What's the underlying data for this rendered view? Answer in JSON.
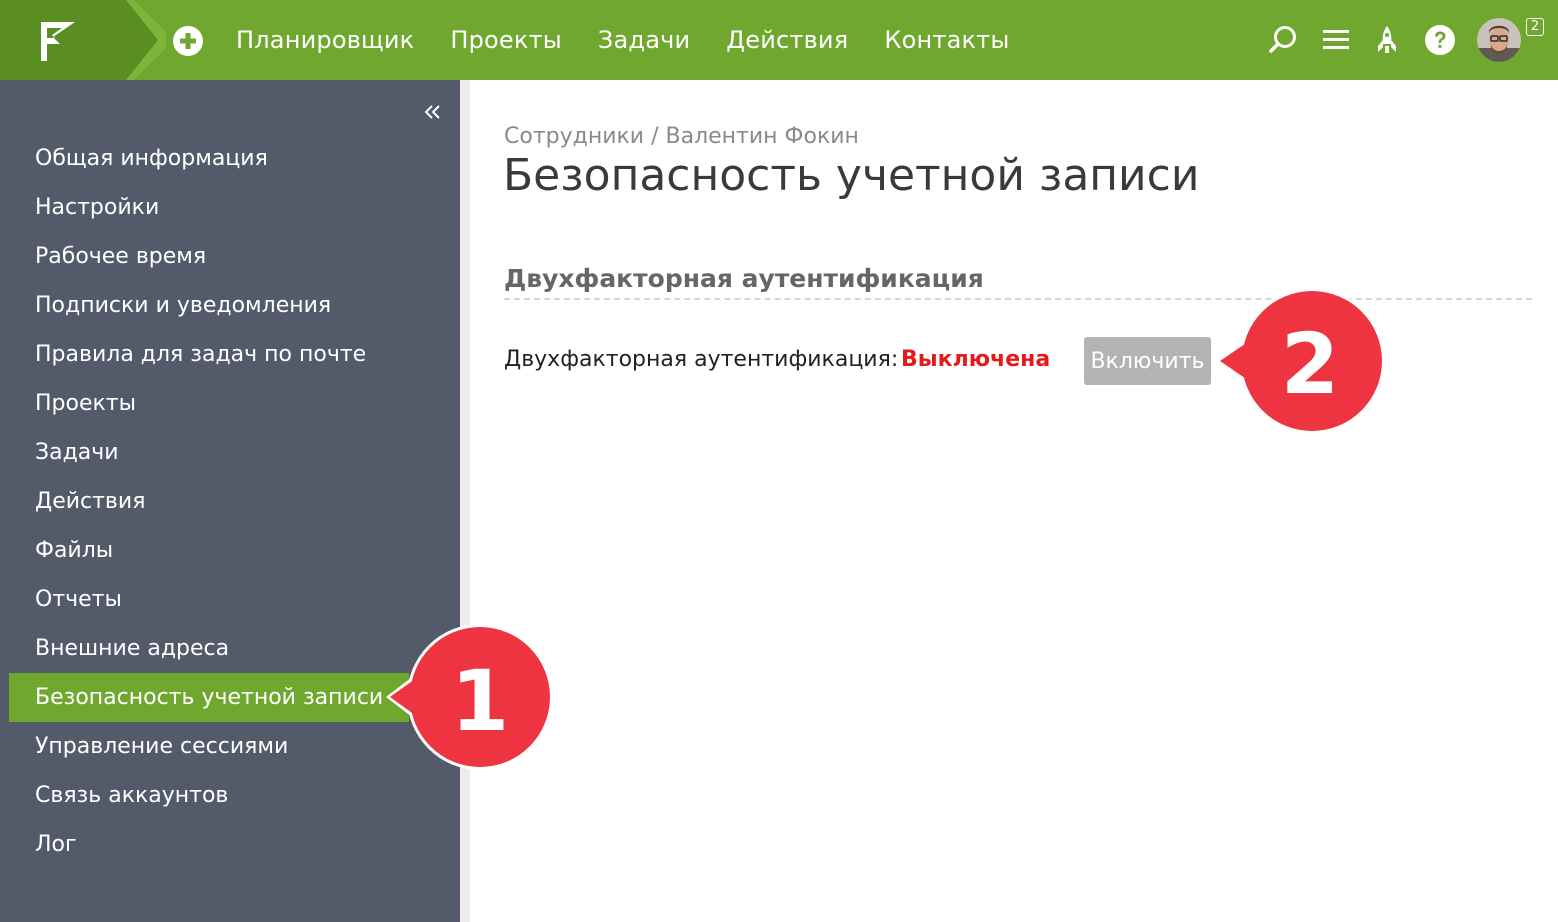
{
  "topbar": {
    "nav": [
      "Планировщик",
      "Проекты",
      "Задачи",
      "Действия",
      "Контакты"
    ],
    "notifications_count": "2",
    "colors": {
      "bar": "#70a82f",
      "logo_bg": "#5b8e22"
    },
    "icons": [
      "flag-logo-icon",
      "plus-circle-icon",
      "search-icon",
      "menu-icon",
      "rocket-icon",
      "help-icon"
    ]
  },
  "sidebar": {
    "items": [
      "Общая информация",
      "Настройки",
      "Рабочее время",
      "Подписки и уведомления",
      "Правила для задач по почте",
      "Проекты",
      "Задачи",
      "Действия",
      "Файлы",
      "Отчеты",
      "Внешние адреса",
      "Безопасность учетной записи",
      "Управление сессиями",
      "Связь аккаунтов",
      "Лог"
    ],
    "active_index": 11,
    "colors": {
      "bg": "#535a6a",
      "active": "#70a82f"
    }
  },
  "main": {
    "breadcrumb": {
      "parent": "Сотрудники",
      "separator": " / ",
      "current": "Валентин Фокин"
    },
    "title": "Безопасность учетной записи",
    "section_title": "Двухфакторная аутентификация",
    "tfa_label": "Двухфакторная аутентификация:",
    "tfa_status": "Выключена",
    "enable_button": "Включить",
    "colors": {
      "status": "#e51b1b",
      "button": "#b3b3b3"
    }
  },
  "callouts": {
    "first": "1",
    "second": "2",
    "color": "#ee3440"
  }
}
